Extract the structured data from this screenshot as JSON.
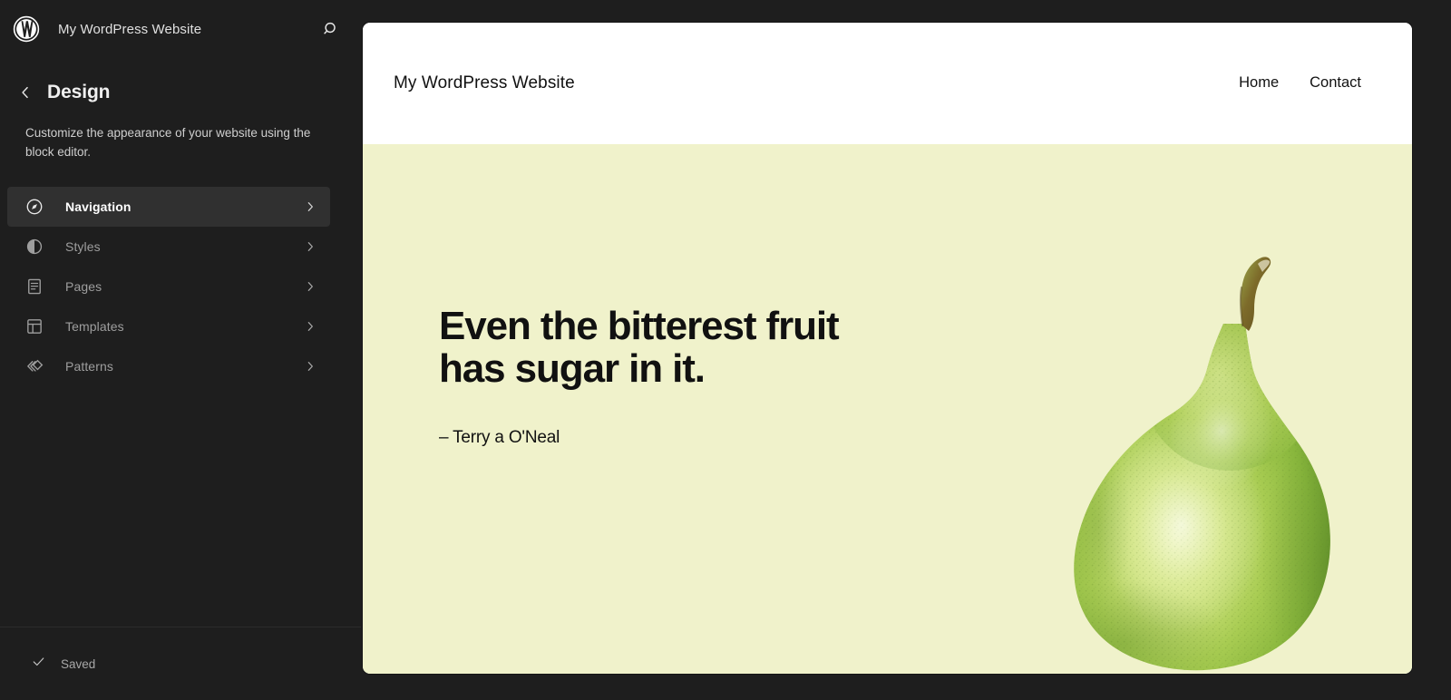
{
  "sidebar": {
    "logo_icon": "wordpress-logo",
    "site_name": "My WordPress Website",
    "search_icon": "search-icon",
    "back_icon": "chevron-left-icon",
    "page_title": "Design",
    "description": "Customize the appearance of your website using the block editor.",
    "nav_items": [
      {
        "label": "Navigation",
        "icon": "compass-icon",
        "selected": true,
        "chevron": "chevron-right-icon"
      },
      {
        "label": "Styles",
        "icon": "contrast-icon",
        "selected": false,
        "chevron": "chevron-right-icon"
      },
      {
        "label": "Pages",
        "icon": "page-icon",
        "selected": false,
        "chevron": "chevron-right-icon"
      },
      {
        "label": "Templates",
        "icon": "layout-icon",
        "selected": false,
        "chevron": "chevron-right-icon"
      },
      {
        "label": "Patterns",
        "icon": "patterns-icon",
        "selected": false,
        "chevron": "chevron-right-icon"
      }
    ],
    "footer": {
      "status_label": "Saved",
      "status_icon": "check-icon"
    }
  },
  "preview": {
    "site_title": "My WordPress Website",
    "nav_links": [
      {
        "label": "Home"
      },
      {
        "label": "Contact"
      }
    ],
    "hero": {
      "quote_line1": "Even the bitterest fruit",
      "quote_line2": "has sugar in it.",
      "citation": "– Terry a O'Neal",
      "image_alt": "green-pear-illustration"
    }
  },
  "colors": {
    "sidebar_bg": "#1e1e1e",
    "sidebar_selected_bg": "#303030",
    "hero_bg": "#f0f2cb",
    "text_primary": "#ffffff",
    "text_muted": "#9e9e9e",
    "pear_green": "#9dc24a",
    "pear_stem": "#7a6a2b"
  }
}
